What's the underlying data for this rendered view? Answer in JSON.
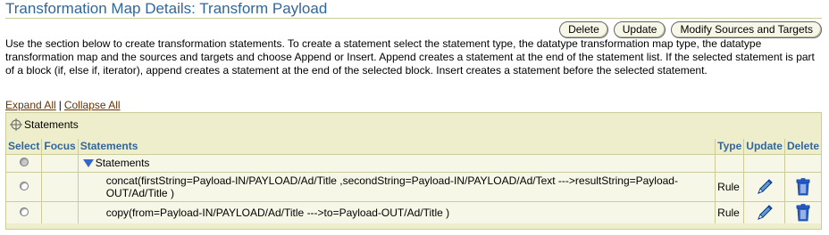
{
  "page": {
    "title": "Transformation Map Details: Transform Payload",
    "instructions": "Use the section below to create transformation statements. To create a statement select the statement type, the datatype transformation map type, the datatype transformation map and the sources and targets and choose Append or Insert. Append creates a statement at the end of the statement list. If the selected statement is part of a block (if, else if, iterator), append creates a statement at the end of the selected block. Insert creates a statement before the selected statement."
  },
  "buttons": {
    "delete": "Delete",
    "update": "Update",
    "modify": "Modify Sources and Targets"
  },
  "links": {
    "expand_all": "Expand All",
    "separator": "|",
    "collapse_all": "Collapse All"
  },
  "tree": {
    "header_label": "Statements",
    "columns": {
      "select": "Select",
      "focus": "Focus",
      "statements": "Statements",
      "type": "Type",
      "update": "Update",
      "delete": "Delete"
    },
    "root": {
      "label": "Statements",
      "expanded": true,
      "selected": false,
      "selectable": false
    },
    "rows": [
      {
        "statement": "concat(firstString=Payload-IN/PAYLOAD/Ad/Title ,secondString=Payload-IN/PAYLOAD/Ad/Text --->resultString=Payload-OUT/Ad/Title )",
        "type": "Rule",
        "update_icon": "pencil-icon",
        "delete_icon": "trash-icon"
      },
      {
        "statement": "copy(from=Payload-IN/PAYLOAD/Ad/Title --->to=Payload-OUT/Ad/Title )",
        "type": "Rule",
        "update_icon": "pencil-icon",
        "delete_icon": "trash-icon"
      }
    ]
  },
  "colors": {
    "title": "#336699",
    "header_text": "#336699",
    "link": "#663300",
    "panel_bg": "#eeeecc",
    "border": "#cccc99",
    "icon_blue": "#3366cc"
  }
}
